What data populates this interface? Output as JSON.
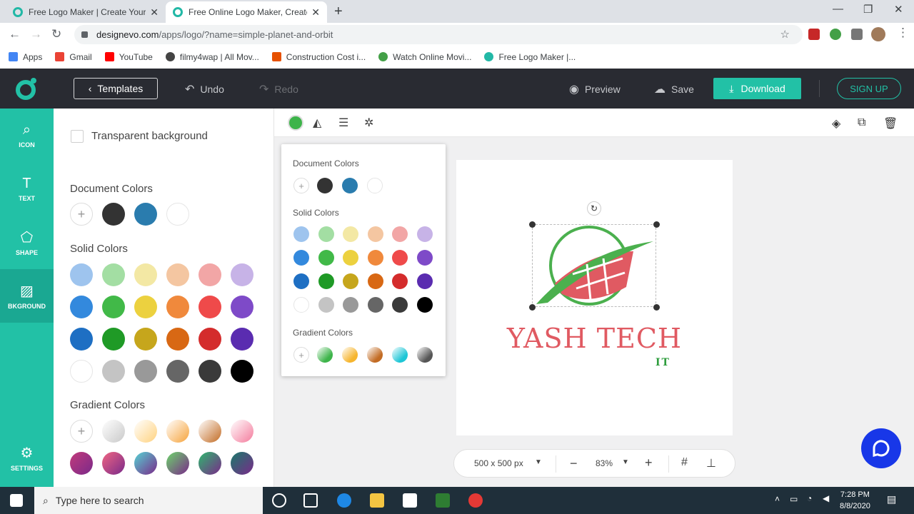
{
  "browser": {
    "tabs": [
      {
        "title": "Free Logo Maker | Create Your Lo"
      },
      {
        "title": "Free Online Logo Maker, Create"
      }
    ],
    "url_host": "designevo.com",
    "url_path": "/apps/logo/?name=simple-planet-and-orbit",
    "bookmarks": [
      {
        "label": "Apps",
        "color": "#4285f4"
      },
      {
        "label": "Gmail",
        "color": "#ea4335"
      },
      {
        "label": "YouTube",
        "color": "#ff0000"
      },
      {
        "label": "filmy4wap | All Mov...",
        "color": "#444444"
      },
      {
        "label": "Construction Cost i...",
        "color": "#e65100"
      },
      {
        "label": "Watch Online Movi...",
        "color": "#43a047"
      },
      {
        "label": "Free Logo Maker |...",
        "color": "#22b8a6"
      }
    ]
  },
  "header": {
    "templates": "Templates",
    "undo": "Undo",
    "redo": "Redo",
    "preview": "Preview",
    "save": "Save",
    "download": "Download",
    "signup": "SIGN UP",
    "brand_color": "#22c1a6"
  },
  "rail": [
    {
      "label": "ICON",
      "icon": "search-icon"
    },
    {
      "label": "TEXT",
      "icon": "text-icon"
    },
    {
      "label": "SHAPE",
      "icon": "shape-icon"
    },
    {
      "label": "BKGROUND",
      "icon": "background-icon"
    },
    {
      "label": "SETTINGS",
      "icon": "gear-icon"
    }
  ],
  "panel": {
    "transparent_label": "Transparent background",
    "document_colors_title": "Document Colors",
    "solid_colors_title": "Solid Colors",
    "gradient_colors_title": "Gradient Colors",
    "document_colors": [
      "#333333",
      "#2a7cae",
      "#ffffff"
    ],
    "solid_colors": [
      [
        "#9ec4ee",
        "#a3dea3",
        "#f3e8a4",
        "#f4c6a1",
        "#f2a6a6",
        "#c7b3e7"
      ],
      [
        "#3389dd",
        "#41b948",
        "#ecd13f",
        "#f0893c",
        "#ef4a4a",
        "#7e4ac8"
      ],
      [
        "#1e6fc3",
        "#1f9a26",
        "#c6a61c",
        "#d86814",
        "#d42c2c",
        "#5a2cb0"
      ],
      [
        "#ffffff",
        "#c4c4c4",
        "#999999",
        "#666666",
        "#3a3a3a",
        "#000000"
      ]
    ],
    "gradient_colors": [
      [
        "#c9c9c9",
        "#ffd27f",
        "#f6a33b",
        "#c26b23",
        "#f47b9c"
      ],
      [
        "#c23a7b",
        "#f06682",
        "#55d3d3",
        "#6cd56a",
        "#2eb86d",
        "#1a7a6a"
      ]
    ]
  },
  "popover": {
    "document_colors_title": "Document Colors",
    "solid_colors_title": "Solid Colors",
    "gradient_colors_title": "Gradient Colors",
    "document_colors": [
      "#333333",
      "#2a7cae",
      "#ffffff"
    ],
    "solid_colors": [
      [
        "#9ec4ee",
        "#a3dea3",
        "#f3e8a4",
        "#f4c6a1",
        "#f2a6a6",
        "#c7b3e7"
      ],
      [
        "#3389dd",
        "#41b948",
        "#ecd13f",
        "#f0893c",
        "#ef4a4a",
        "#7e4ac8"
      ],
      [
        "#1e6fc3",
        "#1f9a26",
        "#c6a61c",
        "#d86814",
        "#d42c2c",
        "#5a2cb0"
      ],
      [
        "#ffffff",
        "#c4c4c4",
        "#999999",
        "#666666",
        "#3a3a3a",
        "#000000"
      ]
    ],
    "gradient_colors": [
      "#3db44a",
      "#f6b52e",
      "#c26b23",
      "#1ec6d6",
      "#555555"
    ]
  },
  "logo": {
    "title": "YASH TECH",
    "subtitle": "IT",
    "title_color": "#e05a62",
    "subtitle_color": "#2e9d3d"
  },
  "zoom": {
    "size": "500 x 500 px",
    "level": "83%"
  },
  "taskbar": {
    "search_placeholder": "Type here to search",
    "time": "7:28 PM",
    "date": "8/8/2020"
  }
}
